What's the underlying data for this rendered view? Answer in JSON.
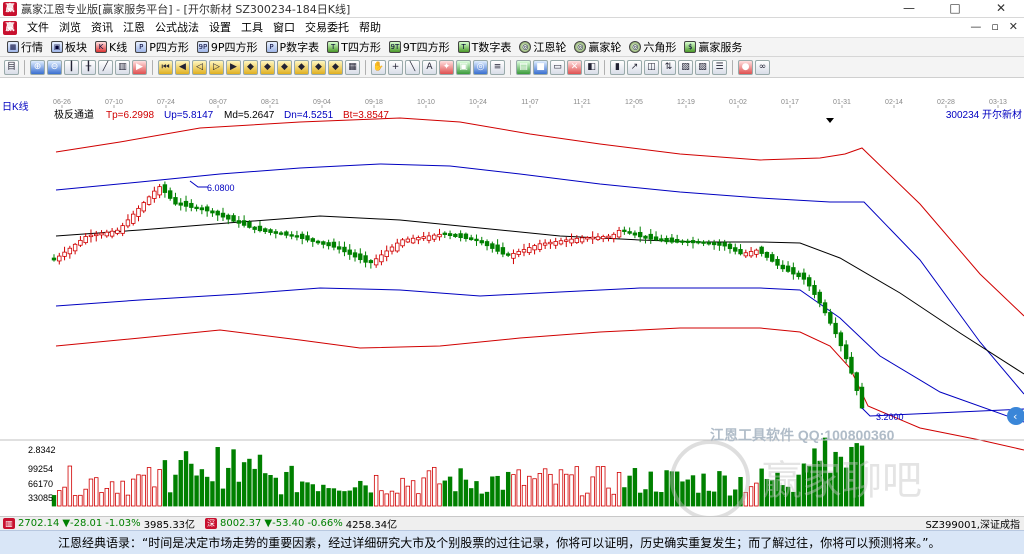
{
  "window": {
    "title": "赢家江恩专业版[赢家服务平台] - [开尔新材  SZ300234-184日K线]",
    "controls": [
      "—",
      "□",
      "✕"
    ]
  },
  "menu": {
    "items": [
      "文件",
      "浏览",
      "资讯",
      "江恩",
      "公式战法",
      "设置",
      "工具",
      "窗口",
      "交易委托",
      "帮助"
    ],
    "right_controls": [
      "—",
      "▫",
      "✕"
    ]
  },
  "toolbar": {
    "items": [
      {
        "label": "行情",
        "icon": "grid-icon"
      },
      {
        "label": "板块",
        "icon": "blocks-icon"
      },
      {
        "label": "K线",
        "icon": "candle-icon"
      },
      {
        "label": "P四方形",
        "icon": "p-square-icon"
      },
      {
        "label": "9P四方形",
        "icon": "p-square-icon"
      },
      {
        "label": "P数字表",
        "icon": "p-table-icon"
      },
      {
        "label": "T四方形",
        "icon": "t-square-icon"
      },
      {
        "label": "9T四方形",
        "icon": "t-square-icon"
      },
      {
        "label": "T数字表",
        "icon": "t-table-icon"
      },
      {
        "label": "江恩轮",
        "icon": "wheel-icon"
      },
      {
        "label": "赢家轮",
        "icon": "wheel-icon"
      },
      {
        "label": "六角形",
        "icon": "hexagon-icon"
      },
      {
        "label": "赢家服务",
        "icon": "dollar-icon"
      }
    ]
  },
  "chart": {
    "period_label": "日K线",
    "indicator_name": "极反通道",
    "params": [
      {
        "label": "Tp=6.2998",
        "color": "#d00000"
      },
      {
        "label": "Up=5.8147",
        "color": "#0000c0"
      },
      {
        "label": "Md=5.2647",
        "color": "#000000"
      },
      {
        "label": "Dn=4.5251",
        "color": "#0000c0"
      },
      {
        "label": "Bt=3.8547",
        "color": "#d00000"
      }
    ],
    "stock_label": "300234  开尔新材",
    "date_ticks": [
      "06-26",
      "07-10",
      "07-24",
      "08-07",
      "08-21",
      "09-04",
      "09-18",
      "10-10",
      "10-24",
      "11-07",
      "11-21",
      "12-05",
      "12-19",
      "01-02",
      "01-17",
      "01-31",
      "02-14",
      "02-28",
      "03-13"
    ],
    "high_label": "6.0800",
    "low_label": "3.2000",
    "volume_axis_labels": [
      "2.8342",
      "99254",
      "66170",
      "33085"
    ],
    "watermark_text": "江恩工具软件  QQ:100800360",
    "watermark_brand": "赢家聊吧"
  },
  "status_bar": {
    "index1": {
      "value": "2702.14",
      "change": "▼-28.01",
      "pct": "-1.03%",
      "amount": "3985.33亿"
    },
    "index2": {
      "value": "8002.37",
      "change": "▼-53.40",
      "pct": "-0.66%",
      "amount": "4258.34亿"
    },
    "right_label": "SZ399001,深证成指"
  },
  "ticker": {
    "text": "江恩经典语录：“时间是决定市场走势的重要因素，经过详细研究大市及个别股票的过往记录，你将可以证明，历史确实重复发生；而了解过往，你将可以预测将来。”。"
  },
  "colors": {
    "up_candle": "#d00000",
    "down_candle": "#008000",
    "outer_band": "#d00000",
    "inner_band": "#0000c0",
    "mid_band": "#000000"
  }
}
